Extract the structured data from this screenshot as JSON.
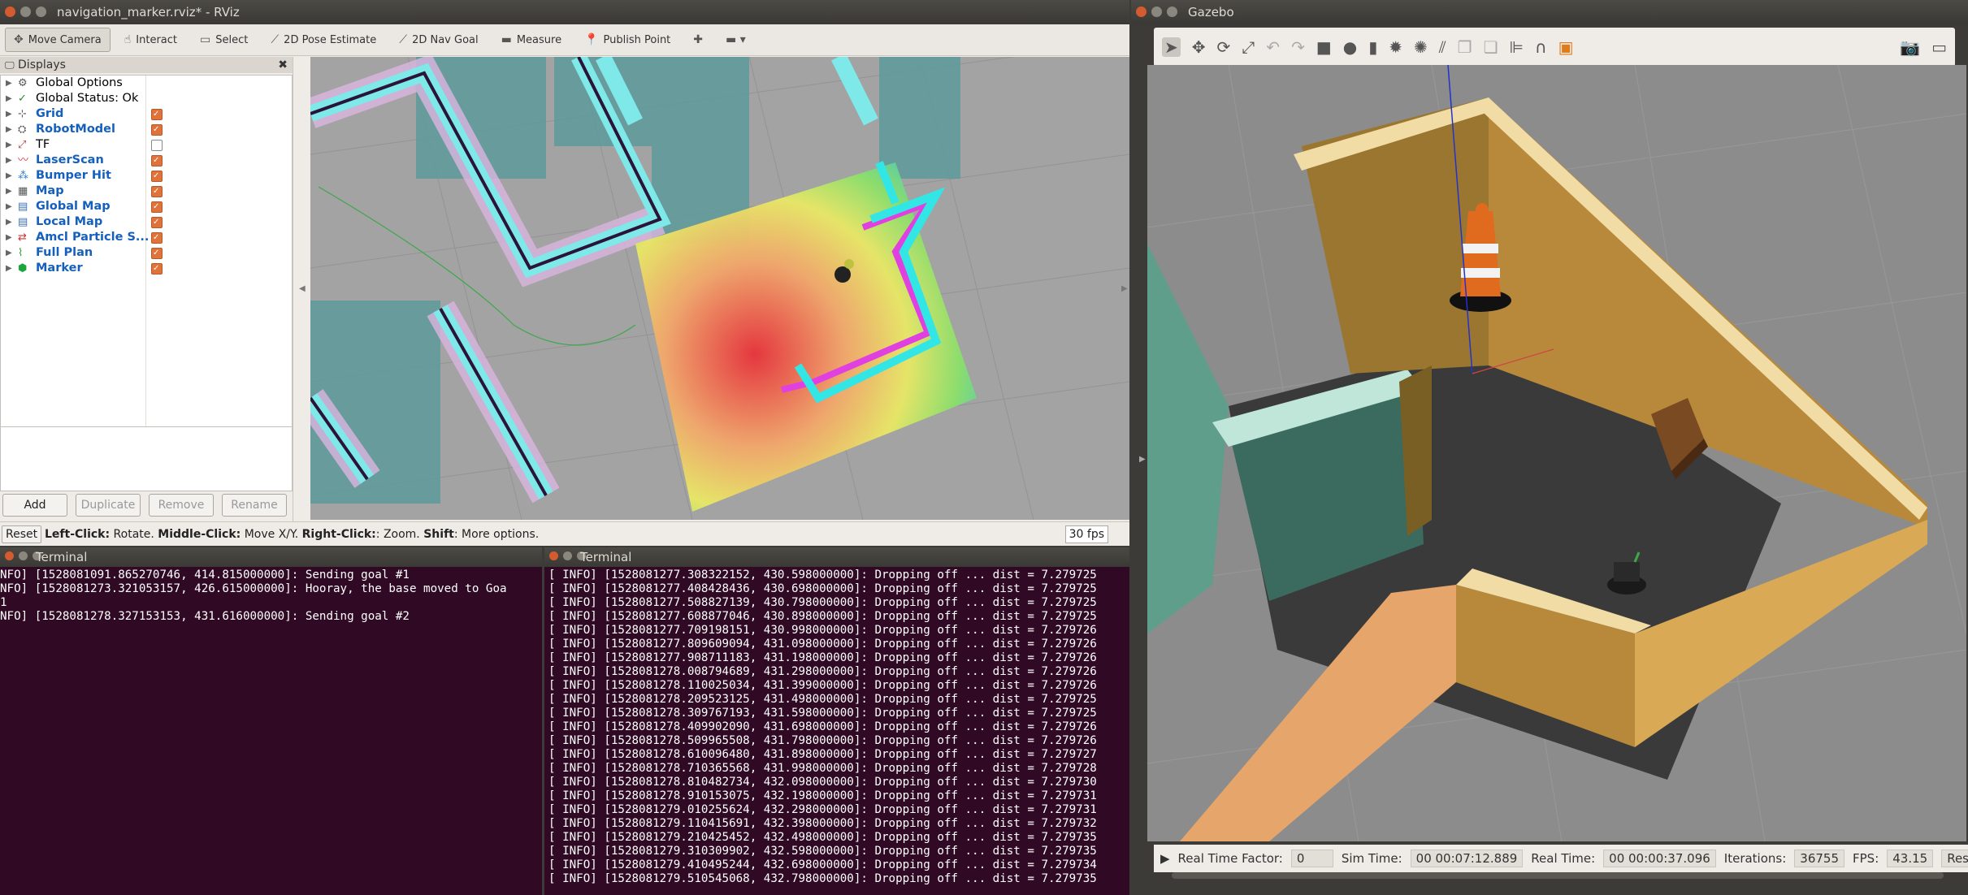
{
  "rviz": {
    "title": "navigation_marker.rviz* - RViz",
    "tools": [
      {
        "label": "Move Camera",
        "icon": "move-camera-icon",
        "glyph": "✥",
        "active": true
      },
      {
        "label": "Interact",
        "icon": "hand-icon",
        "glyph": "☝",
        "active": false
      },
      {
        "label": "Select",
        "icon": "select-box-icon",
        "glyph": "▭",
        "active": false
      },
      {
        "label": "2D Pose Estimate",
        "icon": "green-arrow-icon",
        "glyph": "⟋",
        "active": false
      },
      {
        "label": "2D Nav Goal",
        "icon": "green-arrow-icon",
        "glyph": "⟋",
        "active": false
      },
      {
        "label": "Measure",
        "icon": "ruler-icon",
        "glyph": "▬",
        "active": false
      },
      {
        "label": "Publish Point",
        "icon": "map-pin-icon",
        "glyph": "📍",
        "active": false
      },
      {
        "label": "",
        "icon": "plus-icon",
        "glyph": "✚",
        "active": false
      },
      {
        "label": "",
        "icon": "minus-dropdown-icon",
        "glyph": "▬ ▾",
        "active": false
      }
    ],
    "displays_title": "Displays",
    "displays": [
      {
        "label": "Global Options",
        "glyph": "⚙",
        "color": "#555",
        "blue": false,
        "checkbox": null
      },
      {
        "label": "Global Status: Ok",
        "glyph": "✓",
        "color": "#2a8a2a",
        "blue": false,
        "checkbox": null
      },
      {
        "label": "Grid",
        "glyph": "⊹",
        "color": "#555",
        "blue": true,
        "checkbox": true
      },
      {
        "label": "RobotModel",
        "glyph": "⛭",
        "color": "#555",
        "blue": true,
        "checkbox": true
      },
      {
        "label": "TF",
        "glyph": "⤢",
        "color": "#a44",
        "blue": false,
        "checkbox": false
      },
      {
        "label": "LaserScan",
        "glyph": "〰",
        "color": "#c33",
        "blue": true,
        "checkbox": true
      },
      {
        "label": "Bumper Hit",
        "glyph": "⁂",
        "color": "#2a7ac9",
        "blue": true,
        "checkbox": true
      },
      {
        "label": "Map",
        "glyph": "▦",
        "color": "#555",
        "blue": true,
        "checkbox": true
      },
      {
        "label": "Global Map",
        "glyph": "▤",
        "color": "#3a6fb5",
        "blue": true,
        "checkbox": true
      },
      {
        "label": "Local Map",
        "glyph": "▤",
        "color": "#3a6fb5",
        "blue": true,
        "checkbox": true
      },
      {
        "label": "Amcl Particle S...",
        "glyph": "⇄",
        "color": "#c33",
        "blue": true,
        "checkbox": true
      },
      {
        "label": "Full Plan",
        "glyph": "⌇",
        "color": "#2a9a2a",
        "blue": true,
        "checkbox": true
      },
      {
        "label": "Marker",
        "glyph": "⬢",
        "color": "#1aa63a",
        "blue": true,
        "checkbox": true
      }
    ],
    "buttons": {
      "add": "Add",
      "duplicate": "Duplicate",
      "remove": "Remove",
      "rename": "Rename"
    },
    "status": {
      "reset": "Reset",
      "hint_parts": [
        {
          "b": "Left-Click:"
        },
        {
          "t": " Rotate. "
        },
        {
          "b": "Middle-Click:"
        },
        {
          "t": " Move X/Y. "
        },
        {
          "b": "Right-Click:"
        },
        {
          "t": ": Zoom. "
        },
        {
          "b": "Shift"
        },
        {
          "t": ": More options."
        }
      ],
      "fps": "30 fps"
    }
  },
  "terminal1": {
    "title": "Terminal",
    "lines": [
      "NFO] [1528081091.865270746, 414.815000000]: Sending goal #1",
      "NFO] [1528081273.321053157, 426.615000000]: Hooray, the base moved to Goa",
      "1",
      "NFO] [1528081278.327153153, 431.616000000]: Sending goal #2"
    ]
  },
  "terminal2": {
    "title": "Terminal",
    "lines": [
      "[ INFO] [1528081277.308322152, 430.598000000]: Dropping off ... dist = 7.279725",
      "[ INFO] [1528081277.408428436, 430.698000000]: Dropping off ... dist = 7.279725",
      "[ INFO] [1528081277.508827139, 430.798000000]: Dropping off ... dist = 7.279725",
      "[ INFO] [1528081277.608877046, 430.898000000]: Dropping off ... dist = 7.279725",
      "[ INFO] [1528081277.709198151, 430.998000000]: Dropping off ... dist = 7.279726",
      "[ INFO] [1528081277.809609094, 431.098000000]: Dropping off ... dist = 7.279726",
      "[ INFO] [1528081277.908711183, 431.198000000]: Dropping off ... dist = 7.279726",
      "[ INFO] [1528081278.008794689, 431.298000000]: Dropping off ... dist = 7.279726",
      "[ INFO] [1528081278.110025034, 431.399000000]: Dropping off ... dist = 7.279726",
      "[ INFO] [1528081278.209523125, 431.498000000]: Dropping off ... dist = 7.279725",
      "[ INFO] [1528081278.309767193, 431.598000000]: Dropping off ... dist = 7.279725",
      "[ INFO] [1528081278.409902090, 431.698000000]: Dropping off ... dist = 7.279726",
      "[ INFO] [1528081278.509965508, 431.798000000]: Dropping off ... dist = 7.279726",
      "[ INFO] [1528081278.610096480, 431.898000000]: Dropping off ... dist = 7.279727",
      "[ INFO] [1528081278.710365568, 431.998000000]: Dropping off ... dist = 7.279728",
      "[ INFO] [1528081278.810482734, 432.098000000]: Dropping off ... dist = 7.279730",
      "[ INFO] [1528081278.910153075, 432.198000000]: Dropping off ... dist = 7.279731",
      "[ INFO] [1528081279.010255624, 432.298000000]: Dropping off ... dist = 7.279731",
      "[ INFO] [1528081279.110415691, 432.398000000]: Dropping off ... dist = 7.279732",
      "[ INFO] [1528081279.210425452, 432.498000000]: Dropping off ... dist = 7.279735",
      "[ INFO] [1528081279.310309902, 432.598000000]: Dropping off ... dist = 7.279735",
      "[ INFO] [1528081279.410495244, 432.698000000]: Dropping off ... dist = 7.279734",
      "[ INFO] [1528081279.510545068, 432.798000000]: Dropping off ... dist = 7.279735"
    ]
  },
  "gazebo": {
    "title": "Gazebo",
    "real_time_factor_label": "Real Time Factor:",
    "real_time_factor": "0",
    "sim_time_label": "Sim Time:",
    "sim_time": "00 00:07:12.889",
    "real_time_label": "Real Time:",
    "real_time": "00 00:00:37.096",
    "iterations_label": "Iterations:",
    "iterations": "36755",
    "fps_label": "FPS:",
    "fps": "43.15",
    "reset_label": "Res"
  },
  "colors": {
    "terminal_bg": "#300a24",
    "costmap_cyan": "#33e6e6",
    "costmap_magenta": "#e040e0",
    "wall_tan": "#b8893a"
  }
}
